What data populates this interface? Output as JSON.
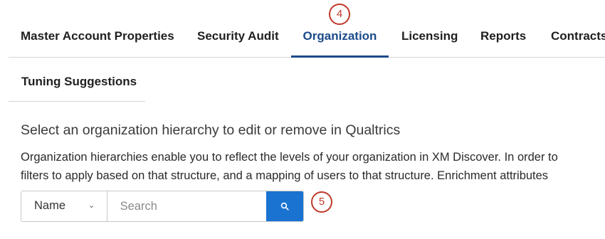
{
  "tabs": [
    {
      "label": "Master Account Properties"
    },
    {
      "label": "Security Audit"
    },
    {
      "label": "Organization"
    },
    {
      "label": "Licensing"
    },
    {
      "label": "Reports"
    },
    {
      "label": "Contracts"
    }
  ],
  "active_tab": "Organization",
  "subtabs": [
    {
      "label": "Tuning Suggestions"
    }
  ],
  "callouts": {
    "tab": "4",
    "search": "5"
  },
  "content": {
    "heading": "Select an organization hierarchy to edit or remove in Qualtrics",
    "description_line1": "Organization hierarchies enable you to reflect the levels of your organization in XM Discover. In order to",
    "description_line2": "filters to apply based on that structure, and a mapping of users to that structure. Enrichment attributes"
  },
  "search": {
    "filter_value": "Name",
    "placeholder": "Search",
    "value": ""
  },
  "colors": {
    "active_tab": "#1a4a8a",
    "search_button": "#1a73d1",
    "callout": "#c0392b"
  },
  "icons": {
    "search_button": "search-icon",
    "dropdown": "chevron-down-icon"
  }
}
